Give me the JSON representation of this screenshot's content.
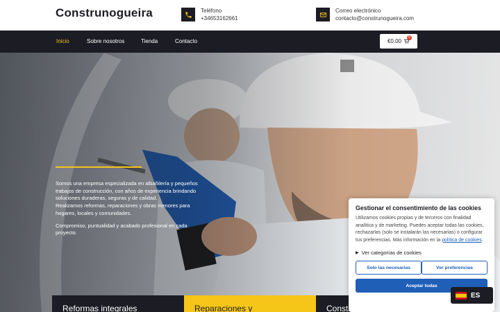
{
  "header": {
    "brand": "Construnogueira",
    "phone": {
      "label": "Teléfono",
      "value": "+34653162661",
      "icon": "phone-icon"
    },
    "email": {
      "label": "Correo electrónico",
      "value": "contacto@construnogueira.com",
      "icon": "mail-icon"
    }
  },
  "nav": {
    "items": [
      {
        "label": "Inicio",
        "active": true
      },
      {
        "label": "Sobre nosotros",
        "active": false
      },
      {
        "label": "Tienda",
        "active": false
      },
      {
        "label": "Contacto",
        "active": false
      }
    ],
    "cart": {
      "total": "€0.00",
      "count": "0",
      "icon": "cart-icon"
    }
  },
  "hero": {
    "paragraphs": [
      "Somos una empresa especializada en albañilería y pequeños trabajos de construcción, con años de experiencia brindando soluciones duraderas, seguras y de calidad.",
      "Realizamos reformas, reparaciones y obras menores para hogares, locales y comunidades.",
      "Compromiso, puntualidad y acabado profesional en cada proyecto."
    ]
  },
  "features": [
    "Reformas integrales",
    "Reparaciones y",
    "Construcción de muros y"
  ],
  "cookie": {
    "title": "Gestionar el consentimiento de las cookies",
    "body": "Utilizamos cookies propias y de terceros con finalidad analítica y de marketing. Puedes aceptar todas las cookies, rechazarlas (solo se instalarán las necesarias) o configurar tus preferencias. Más información en la",
    "link": "política de cookies",
    "categories": "Ver categorías de cookies",
    "btn_necessary": "Solo las necesarias",
    "btn_preferences": "Ver preferencias",
    "btn_accept": "Aceptar todas"
  },
  "language": {
    "code": "ES",
    "flag": "spain-flag-icon"
  },
  "colors": {
    "dark": "#1c1c24",
    "accent": "#f5c518",
    "link": "#1f5fb8"
  }
}
